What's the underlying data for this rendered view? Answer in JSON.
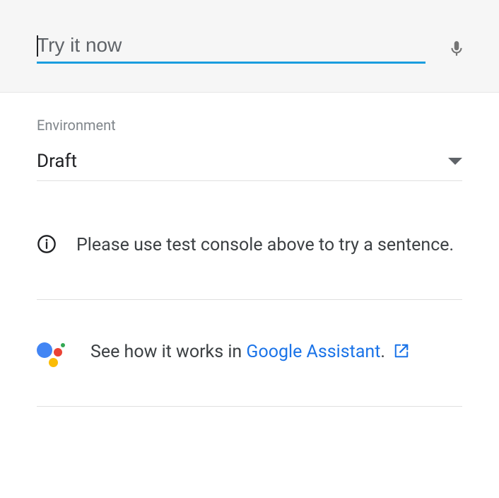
{
  "input": {
    "placeholder": "Try it now",
    "value": ""
  },
  "environment": {
    "label": "Environment",
    "selected": "Draft"
  },
  "info": {
    "message": "Please use test console above to try a sentence."
  },
  "assistant": {
    "prefix": "See how it works in ",
    "link_text": "Google Assistant",
    "suffix": "."
  }
}
